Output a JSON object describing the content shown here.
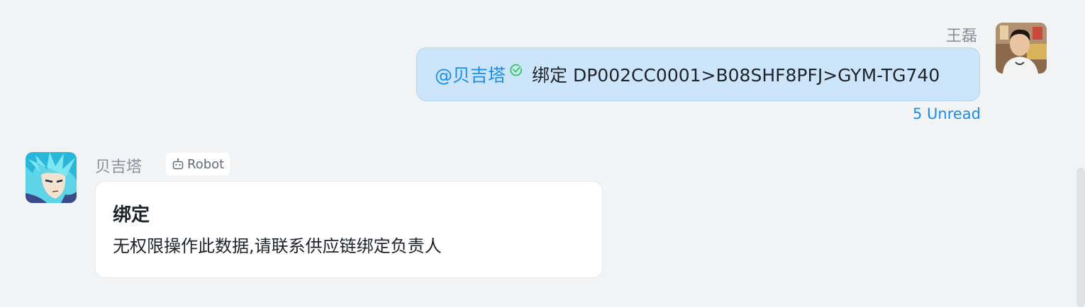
{
  "outgoing": {
    "sender_name": "王磊",
    "mention": "@贝吉塔",
    "text": "绑定 DP002CC0001>B08SHF8PFJ>GYM-TG740",
    "read_status": "5 Unread"
  },
  "incoming": {
    "sender_name": "贝吉塔",
    "badge_label": "Robot",
    "card_title": "绑定",
    "card_body": "无权限操作此数据,请联系供应链绑定负责人"
  },
  "icons": {
    "read_check": "check-circle-icon",
    "robot": "robot-icon"
  },
  "colors": {
    "background": "#f2f3f5",
    "bubble_out": "#cce5fb",
    "accent": "#1a8cf0",
    "check_green": "#34c759"
  }
}
